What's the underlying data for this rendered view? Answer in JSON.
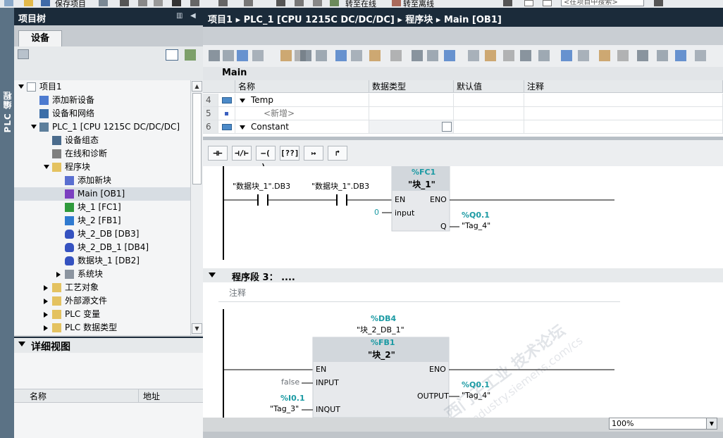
{
  "top_toolbar": {
    "save_label": "保存项目",
    "go_online_label": "转至在线",
    "go_offline_label": "转至离线",
    "search_placeholder": "<在项目中搜索>"
  },
  "side_tab": {
    "label": "PLC 编程"
  },
  "project_tree": {
    "title": "项目树",
    "devices_tab": "设备",
    "items": [
      {
        "label": "项目1",
        "level": 0,
        "arrow": "down",
        "icon": "project-icon"
      },
      {
        "label": "添加新设备",
        "level": 1,
        "arrow": "",
        "icon": "add-device-icon"
      },
      {
        "label": "设备和网络",
        "level": 1,
        "arrow": "",
        "icon": "network-icon"
      },
      {
        "label": "PLC_1 [CPU 1215C DC/DC/DC]",
        "level": 1,
        "arrow": "down",
        "icon": "plc-icon"
      },
      {
        "label": "设备组态",
        "level": 2,
        "arrow": "",
        "icon": "device-config-icon"
      },
      {
        "label": "在线和诊断",
        "level": 2,
        "arrow": "",
        "icon": "diagnostics-icon"
      },
      {
        "label": "程序块",
        "level": 2,
        "arrow": "down",
        "icon": "folder-icon"
      },
      {
        "label": "添加新块",
        "level": 3,
        "arrow": "",
        "icon": "add-block-icon"
      },
      {
        "label": "Main [OB1]",
        "level": 3,
        "arrow": "",
        "icon": "ob-icon",
        "selected": true
      },
      {
        "label": "块_1 [FC1]",
        "level": 3,
        "arrow": "",
        "icon": "fc-icon"
      },
      {
        "label": "块_2 [FB1]",
        "level": 3,
        "arrow": "",
        "icon": "fb-icon"
      },
      {
        "label": "块_2_DB [DB3]",
        "level": 3,
        "arrow": "",
        "icon": "db-icon"
      },
      {
        "label": "块_2_DB_1 [DB4]",
        "level": 3,
        "arrow": "",
        "icon": "db-icon"
      },
      {
        "label": "数据块_1 [DB2]",
        "level": 3,
        "arrow": "",
        "icon": "db-icon"
      },
      {
        "label": "系统块",
        "level": 3,
        "arrow": "right",
        "icon": "system-block-icon"
      },
      {
        "label": "工艺对象",
        "level": 2,
        "arrow": "right",
        "icon": "folder-icon"
      },
      {
        "label": "外部源文件",
        "level": 2,
        "arrow": "right",
        "icon": "folder-icon"
      },
      {
        "label": "PLC 变量",
        "level": 2,
        "arrow": "right",
        "icon": "folder-icon"
      },
      {
        "label": "PLC 数据类型",
        "level": 2,
        "arrow": "right",
        "icon": "folder-icon"
      }
    ]
  },
  "detail_view": {
    "title": "详细视图",
    "col_name": "名称",
    "col_address": "地址"
  },
  "editor": {
    "breadcrumb": "项目1 ▸ PLC_1 [CPU 1215C DC/DC/DC] ▸ 程序块 ▸ Main [OB1]",
    "block_name": "Main",
    "interface": {
      "headers": {
        "name": "名称",
        "datatype": "数据类型",
        "default": "默认值",
        "comment": "注释"
      },
      "rows": [
        {
          "num": "4",
          "name": "Temp",
          "expand": true
        },
        {
          "num": "5",
          "name": "<新增>",
          "placeholder": true
        },
        {
          "num": "6",
          "name": "Constant",
          "expand": true
        }
      ]
    },
    "lad_buttons": [
      "⊣⊢",
      "⊣/⊢",
      "–( )–",
      "[??]",
      "↦",
      "↱"
    ],
    "network2": {
      "contact1_operand": "\"数据块_1\".DB3",
      "contact2_operand": "\"数据块_1\".DB3",
      "box_address": "%FC1",
      "box_name": "\"块_1\"",
      "pin_en": "EN",
      "pin_eno": "ENO",
      "pin_input": "input",
      "pin_q": "Q",
      "input_value": "0",
      "out_address": "%Q0.1",
      "out_tag": "\"Tag_4\""
    },
    "network3": {
      "title": "程序段 3： ....",
      "comment": "注释",
      "instance_address": "%DB4",
      "instance_name": "\"块_2_DB_1\"",
      "box_address": "%FB1",
      "box_name": "\"块_2\"",
      "pin_en": "EN",
      "pin_eno": "ENO",
      "pin_input": "INPUT",
      "pin_output": "OUTPUT",
      "pin_inqut": "INQUT",
      "input_value": "false",
      "inqut_address": "%I0.1",
      "inqut_tag": "\"Tag_3\"",
      "out_address": "%Q0.1",
      "out_tag": "\"Tag_4\""
    },
    "watermark_1": "西门子工业",
    "watermark_2": "support.industry.siemens.com/cs",
    "watermark_3": "技术论坛",
    "zoom": "100%"
  },
  "colors": {
    "header_dark": "#1b2b3a",
    "address_teal": "#1b9aa3",
    "box_fill": "#e7e9ec"
  }
}
